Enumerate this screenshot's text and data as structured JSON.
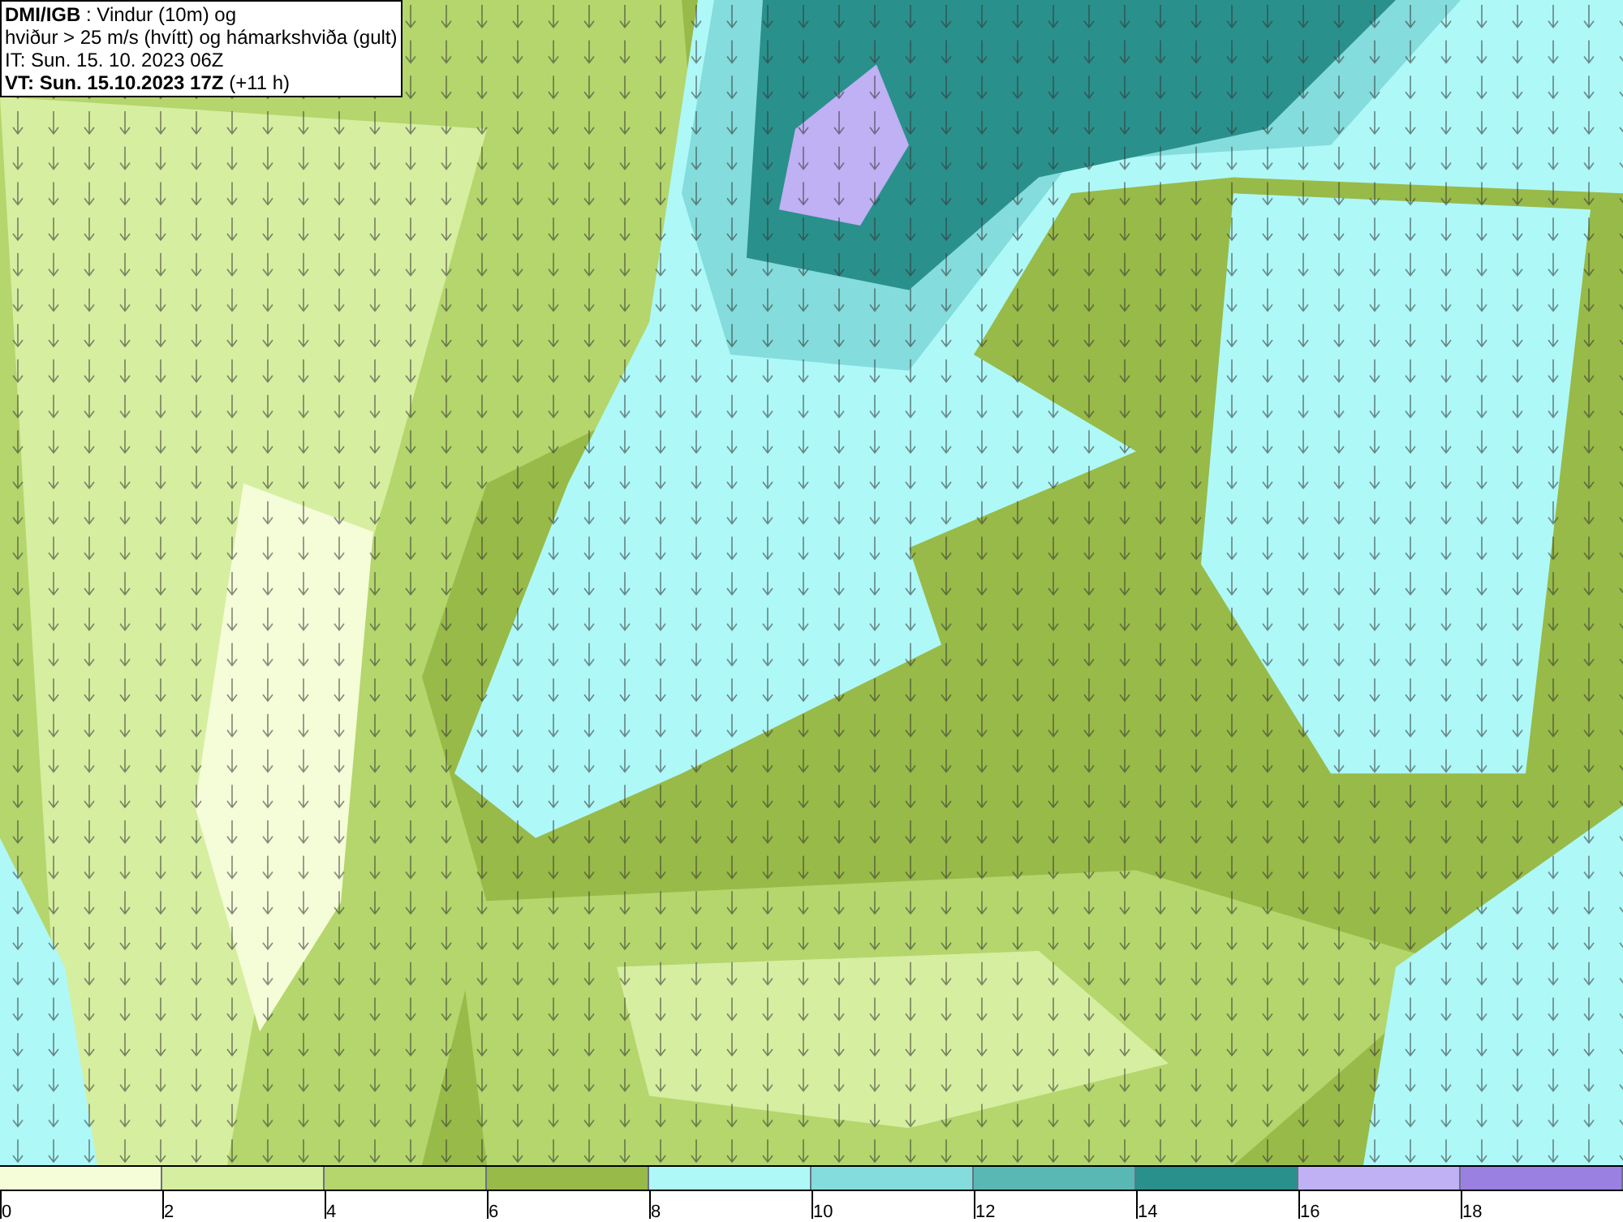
{
  "header": {
    "lines": [
      "**DMI/IGB** : Vindur (10m) og",
      "hviður > 25 m/s (hvítt) og hámarkshviða (gult)",
      "IT: Sun. 15. 10. 2023 06Z",
      "**VT: Sun. 15.10.2023 17Z** (+11 h)"
    ]
  },
  "legend": {
    "bins": [
      {
        "color": "#f5fcd8"
      },
      {
        "color": "#d6eea0"
      },
      {
        "color": "#b4d66c"
      },
      {
        "color": "#98ba48"
      },
      {
        "color": "#aef8f8"
      },
      {
        "color": "#84dcdc"
      },
      {
        "color": "#5ab8b4"
      },
      {
        "color": "#2a908c"
      },
      {
        "color": "#c0b0f4"
      },
      {
        "color": "#9a80e0"
      }
    ],
    "ticks": [
      "0",
      "2",
      "4",
      "6",
      "8",
      "10",
      "12",
      "14",
      "16",
      "18"
    ]
  }
}
